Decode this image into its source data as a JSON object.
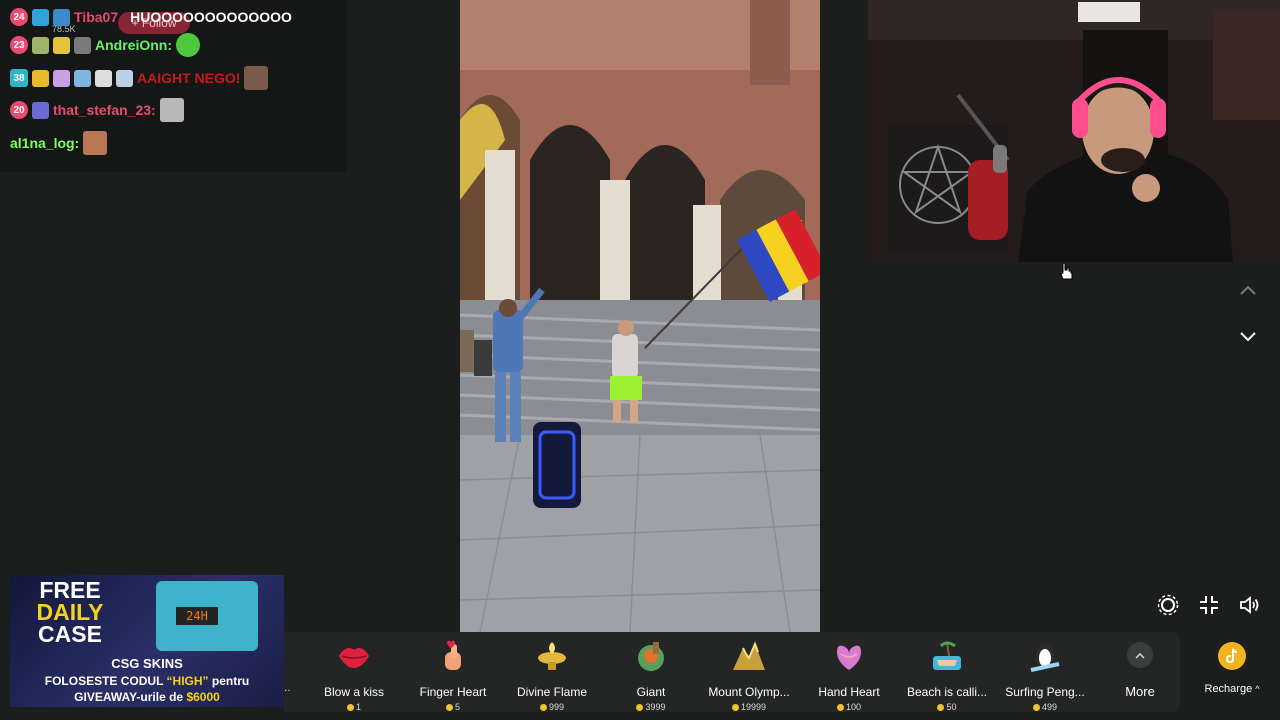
{
  "chat": {
    "ghost_follow": "+ Follow",
    "ghost_viewers": "78.5K",
    "messages": [
      {
        "badge": "24",
        "name": "Tiba07",
        "text": "HUOOOOOOOOOOOOO",
        "name_color": "#e94a6e"
      },
      {
        "badge": "23",
        "name": "AndreiOnn:",
        "text": "",
        "name_color": "#6bf06b"
      },
      {
        "badge": "38",
        "name": "AAIGHT NEGO!",
        "text": "",
        "name_color": "#c71b1b"
      },
      {
        "badge": "20",
        "name": "that_stefan_23:",
        "text": "",
        "name_color": "#e94a6e"
      },
      {
        "badge": "",
        "name": "al1na_log:",
        "text": "",
        "name_color": "#7bff5a"
      }
    ]
  },
  "gifts": [
    {
      "name": "Blow a kiss",
      "cost": "1",
      "icon": "lips-icon",
      "color": "#e21f3c"
    },
    {
      "name": "Finger Heart",
      "cost": "5",
      "icon": "finger-heart-icon",
      "color": "#f3a275"
    },
    {
      "name": "Divine Flame",
      "cost": "999",
      "icon": "lamp-icon",
      "color": "#e2b93e"
    },
    {
      "name": "Giant",
      "cost": "3999",
      "icon": "giant-icon",
      "color": "#5aa05c"
    },
    {
      "name": "Mount Olymp...",
      "cost": "19999",
      "icon": "mountain-icon",
      "color": "#c9a03c"
    },
    {
      "name": "Hand Heart",
      "cost": "100",
      "icon": "hand-heart-icon",
      "color": "#d77bd0"
    },
    {
      "name": "Beach is calli...",
      "cost": "50",
      "icon": "beach-icon",
      "color": "#46b7d8"
    },
    {
      "name": "Surfing Peng...",
      "cost": "499",
      "icon": "penguin-icon",
      "color": "#9bd7f0"
    }
  ],
  "more_label": "More",
  "recharge_label": "Recharge",
  "ad": {
    "line1": "FREE",
    "line2": "DAILY",
    "line3": "CASE",
    "brand": "CSG SKINS",
    "code_prefix": "FOLOSESTE CODUL",
    "code": "“HIGH”",
    "code_suffix": "pentru",
    "giveaway_prefix": "GIVEAWAY-urile de",
    "amount": "$6000",
    "box_label": "24H"
  }
}
